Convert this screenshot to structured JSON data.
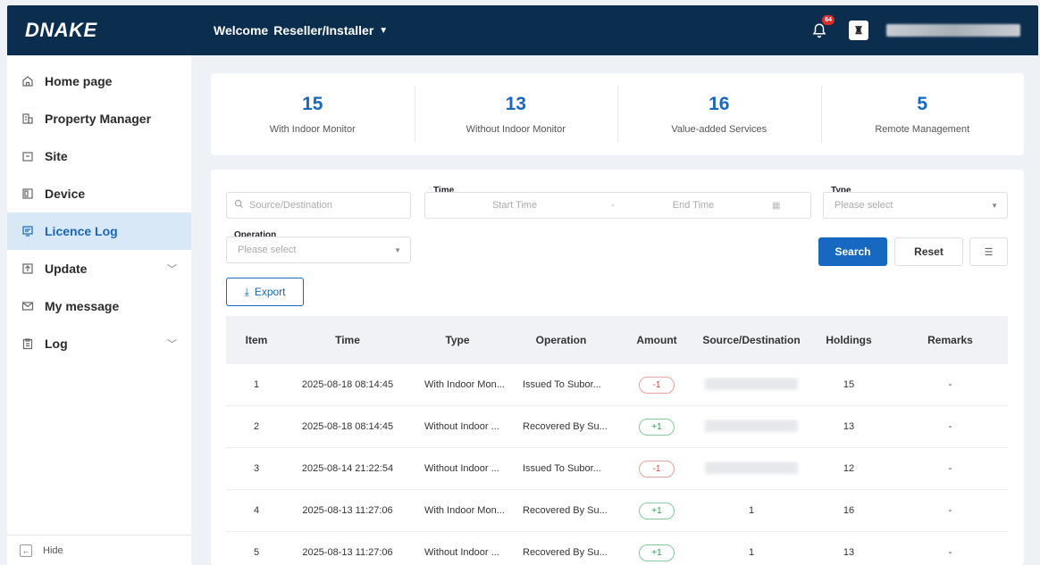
{
  "header": {
    "logo": "DNAKE",
    "welcome_label": "Welcome",
    "role": "Reseller/Installer",
    "notification_count": "64"
  },
  "sidebar": {
    "items": [
      {
        "label": "Home page",
        "icon": "home-icon"
      },
      {
        "label": "Property Manager",
        "icon": "building-icon"
      },
      {
        "label": "Site",
        "icon": "folder-icon"
      },
      {
        "label": "Device",
        "icon": "device-icon"
      },
      {
        "label": "Licence Log",
        "icon": "licence-icon",
        "active": true
      },
      {
        "label": "Update",
        "icon": "update-icon",
        "expandable": true
      },
      {
        "label": "My message",
        "icon": "mail-icon"
      },
      {
        "label": "Log",
        "icon": "clipboard-icon",
        "expandable": true
      }
    ],
    "hide_label": "Hide"
  },
  "stats": [
    {
      "value": "15",
      "label": "With Indoor Monitor"
    },
    {
      "value": "13",
      "label": "Without Indoor Monitor"
    },
    {
      "value": "16",
      "label": "Value-added Services"
    },
    {
      "value": "5",
      "label": "Remote Management"
    }
  ],
  "filters": {
    "source_placeholder": "Source/Destination",
    "time_label": "Time",
    "start_placeholder": "Start Time",
    "time_separator": "-",
    "end_placeholder": "End Time",
    "type_label": "Type",
    "type_placeholder": "Please select",
    "operation_label": "Operation",
    "operation_placeholder": "Please select",
    "search_label": "Search",
    "reset_label": "Reset",
    "export_label": "Export"
  },
  "table": {
    "columns": [
      "Item",
      "Time",
      "Type",
      "Operation",
      "Amount",
      "Source/Destination",
      "Holdings",
      "Remarks"
    ],
    "rows": [
      {
        "item": "1",
        "time": "2025-08-18 08:14:45",
        "type": "With Indoor Mon...",
        "operation": "Issued To Subor...",
        "amount": "-1",
        "source": "",
        "holdings": "15",
        "remarks": "-"
      },
      {
        "item": "2",
        "time": "2025-08-18 08:14:45",
        "type": "Without Indoor ...",
        "operation": "Recovered By Su...",
        "amount": "+1",
        "source": "",
        "holdings": "13",
        "remarks": "-"
      },
      {
        "item": "3",
        "time": "2025-08-14 21:22:54",
        "type": "Without Indoor ...",
        "operation": "Issued To Subor...",
        "amount": "-1",
        "source": "",
        "holdings": "12",
        "remarks": "-"
      },
      {
        "item": "4",
        "time": "2025-08-13 11:27:06",
        "type": "With Indoor Mon...",
        "operation": "Recovered By Su...",
        "amount": "+1",
        "source": "1",
        "holdings": "16",
        "remarks": "-"
      },
      {
        "item": "5",
        "time": "2025-08-13 11:27:06",
        "type": "Without Indoor ...",
        "operation": "Recovered By Su...",
        "amount": "+1",
        "source": "1",
        "holdings": "13",
        "remarks": "-"
      }
    ]
  },
  "colors": {
    "header_bg": "#0b2e4f",
    "accent": "#1668c1",
    "negative": "#d94848",
    "positive": "#2e9b52"
  }
}
